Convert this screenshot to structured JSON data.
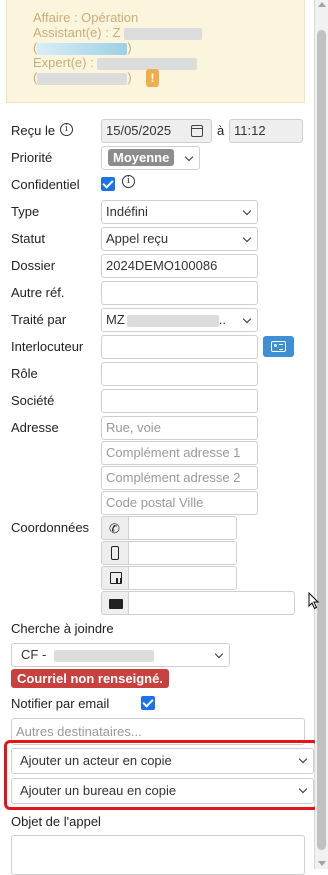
{
  "info": {
    "affaire": "Affaire : Opération",
    "assistant": "Assistant(e) : Z",
    "assistant_paren_open": "(",
    "assistant_paren_close": ")",
    "expert": "Expert(e) :",
    "expert_paren_open": "(",
    "expert_paren_close": ")",
    "warning_glyph": "!"
  },
  "form": {
    "recu_le": {
      "label": "Reçu le",
      "date": "15/05/2025",
      "a": "à",
      "time": "11:12"
    },
    "priorite": {
      "label": "Priorité",
      "value": "Moyenne"
    },
    "confidentiel": {
      "label": "Confidentiel",
      "checked": true
    },
    "type": {
      "label": "Type",
      "value": "Indéfini"
    },
    "statut": {
      "label": "Statut",
      "value": "Appel reçu"
    },
    "dossier": {
      "label": "Dossier",
      "value": "2024DEMO100086"
    },
    "autre_ref": {
      "label": "Autre réf.",
      "value": ""
    },
    "traite_par": {
      "label": "Traité par",
      "value": "MZ",
      "suffix": ".."
    },
    "interlocuteur": {
      "label": "Interlocuteur",
      "value": ""
    },
    "role": {
      "label": "Rôle",
      "value": ""
    },
    "societe": {
      "label": "Société",
      "value": ""
    },
    "adresse": {
      "label": "Adresse",
      "placeholder_rue": "Rue, voie",
      "placeholder_comp1": "Complément adresse 1",
      "placeholder_comp2": "Complément adresse 2",
      "placeholder_cp": "Code postal Ville"
    },
    "coordonnees": {
      "label": "Coordonnées",
      "phone_icon": "phone-icon",
      "mobile_icon": "mobile-icon",
      "fax_icon": "fax-icon",
      "email_icon": "envelope-icon"
    },
    "cherche_a_joindre": {
      "label": "Cherche à joindre",
      "value": "CF -"
    },
    "alert_text": "Courriel non renseigné.",
    "notifier": {
      "label": "Notifier par email",
      "checked": true
    },
    "autres_destinataires": {
      "placeholder": "Autres destinataires..."
    },
    "ajouter_acteur": "Ajouter un acteur en copie",
    "ajouter_bureau": "Ajouter un bureau en copie",
    "objet": {
      "label": "Objet de l'appel",
      "value": ""
    }
  },
  "colors": {
    "info_bg": "#fcf5dd",
    "info_text": "#c8ad7a",
    "accent_blue": "#1a73e8",
    "card_button": "#3d8fd6",
    "alert_red": "#c9413f",
    "highlight_red": "#e3171b",
    "warning_orange": "#f0ad4e"
  }
}
